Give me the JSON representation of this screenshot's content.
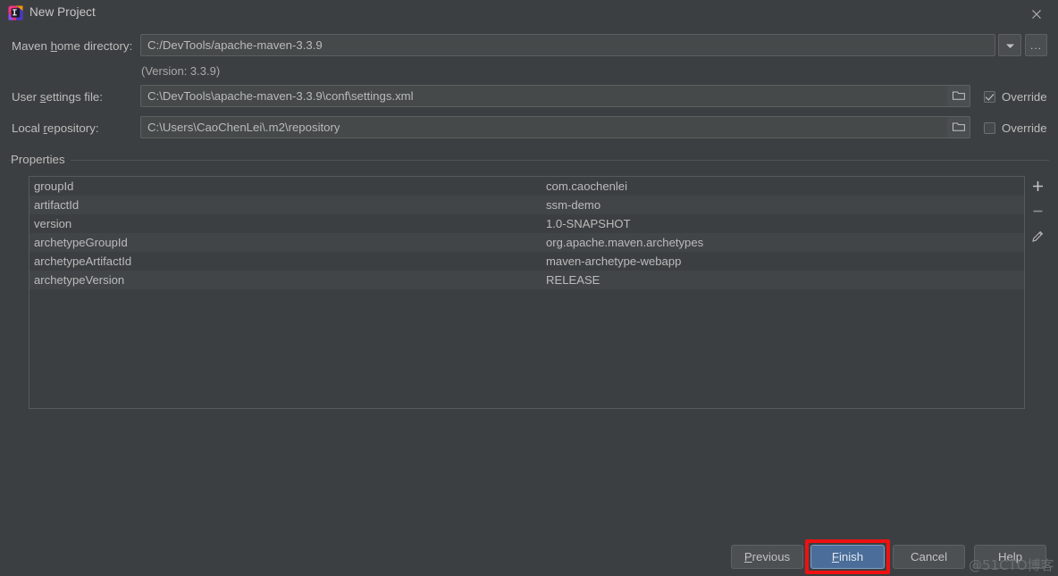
{
  "window": {
    "title": "New Project",
    "app_icon": "intellij-idea-logo",
    "close_icon": "close-icon"
  },
  "form": {
    "maven_home": {
      "label_pre": "Maven ",
      "label_mnemonic": "h",
      "label_post": "ome directory:",
      "value": "C:/DevTools/apache-maven-3.3.9",
      "dropdown_icon": "chevron-down-icon",
      "browse_label": "..."
    },
    "version_note": "(Version: 3.3.9)",
    "user_settings": {
      "label_pre": "User ",
      "label_mnemonic": "s",
      "label_post": "ettings file:",
      "value": "C:\\DevTools\\apache-maven-3.3.9\\conf\\settings.xml",
      "folder_icon": "folder-icon",
      "override_label": "Override",
      "override_checked": true
    },
    "local_repository": {
      "label_pre": "Local ",
      "label_mnemonic": "r",
      "label_post": "epository:",
      "value": "C:\\Users\\CaoChenLei\\.m2\\repository",
      "folder_icon": "folder-icon",
      "override_label": "Override",
      "override_checked": false
    }
  },
  "properties": {
    "group_label": "Properties",
    "rows": [
      {
        "key": "groupId",
        "value": "com.caochenlei"
      },
      {
        "key": "artifactId",
        "value": "ssm-demo"
      },
      {
        "key": "version",
        "value": "1.0-SNAPSHOT"
      },
      {
        "key": "archetypeGroupId",
        "value": "org.apache.maven.archetypes"
      },
      {
        "key": "archetypeArtifactId",
        "value": "maven-archetype-webapp"
      },
      {
        "key": "archetypeVersion",
        "value": "RELEASE"
      }
    ],
    "tools": [
      {
        "name": "add-property-button",
        "icon": "plus-icon"
      },
      {
        "name": "remove-property-button",
        "icon": "minus-icon"
      },
      {
        "name": "edit-property-button",
        "icon": "pencil-icon"
      }
    ]
  },
  "buttons": {
    "previous": {
      "pre": "",
      "mnemonic": "P",
      "post": "revious"
    },
    "finish": {
      "pre": "",
      "mnemonic": "F",
      "post": "inish"
    },
    "cancel": {
      "label": "Cancel"
    },
    "help": {
      "label": "Help"
    }
  },
  "annotation": {
    "highlight_color": "#ee1111",
    "target": "finish-button"
  },
  "watermark": {
    "text": "@51CTO博客"
  },
  "colors": {
    "background": "#3c3f41",
    "field_bg": "#45494a",
    "row_alt": "#414547",
    "primary_button": "#4a6d99",
    "text": "#bbbbbb"
  }
}
